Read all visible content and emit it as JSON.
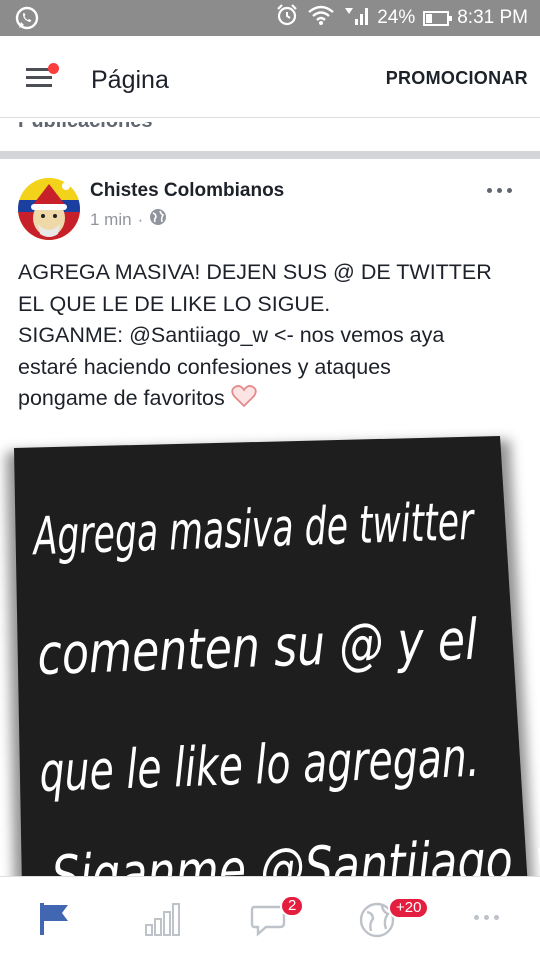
{
  "status_bar": {
    "battery_percent": "24%",
    "time": "8:31 PM",
    "icons": [
      "whatsapp-icon",
      "alarm-icon",
      "wifi-icon",
      "signal-icon",
      "battery-icon"
    ]
  },
  "header": {
    "title": "Página",
    "promote_label": "PROMOCIONAR",
    "menu_notification_color": "#fa3e3e"
  },
  "section_label": "Publicaciones",
  "post": {
    "author": "Chistes Colombianos",
    "time": "1 min",
    "privacy_icon": "globe-icon",
    "text": "AGREGA MASIVA! DEJEN SUS @ DE TWITTER\nEL QUE LE DE LIKE LO SIGUE.\nSIGANME: @Santiiago_w  <- nos vemos aya\nestaré haciendo confesiones y ataques\npongame de favoritos",
    "emoji": "heart-outline",
    "image_lines": [
      "Agrega masiva de twitter",
      "comenten su @ y el",
      "que le like lo agregan.",
      "Siganme @Santiiago_w"
    ]
  },
  "bottom_nav": {
    "items": [
      {
        "icon": "flag-icon",
        "active": true
      },
      {
        "icon": "insights-icon",
        "active": false
      },
      {
        "icon": "messages-icon",
        "badge": "2"
      },
      {
        "icon": "notifications-globe-icon",
        "badge": "+20"
      },
      {
        "icon": "more-icon",
        "active": false
      }
    ]
  },
  "colors": {
    "status_bar_bg": "#8c8c8c",
    "accent_blue": "#4267b2",
    "badge_red": "#e41e3f",
    "image_bg": "#1e1e1e"
  }
}
